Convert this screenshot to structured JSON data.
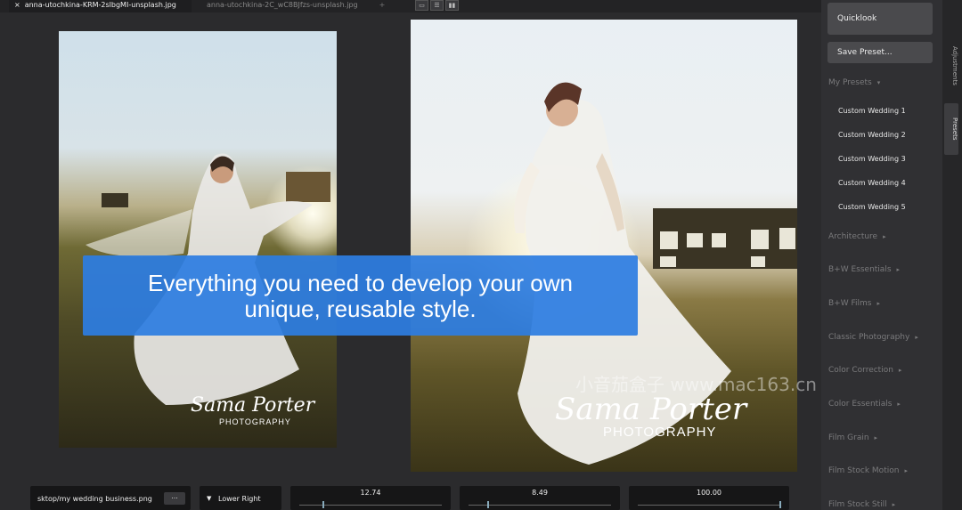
{
  "tabs": [
    {
      "label": "anna-utochkina-KRM-2slbgMI-unsplash.jpg",
      "active": true,
      "close_glyph": "×"
    },
    {
      "label": "anna-utochkina-2C_wC8BJfzs-unsplash.jpg",
      "active": false,
      "add_glyph": "+"
    }
  ],
  "view_buttons": [
    "single-view-icon",
    "split-horizontal-icon",
    "split-vertical-icon"
  ],
  "watermarks": {
    "left": {
      "script": "Sama Porter",
      "sub": "PHOTOGRAPHY"
    },
    "right": {
      "script": "Sama Porter",
      "sub": "PHOTOGRAPHY"
    }
  },
  "caption": {
    "line1": "Everything you need to develop your own",
    "line2": "unique, reusable style.",
    "color": "#2d7de1"
  },
  "site_watermark": "小音茄盒子 www.mac163.cn",
  "controls": {
    "path_value": "sktop/my wedding business.png",
    "browse_label": "...",
    "position_value": "Lower Right",
    "sliders": [
      {
        "value": "12.74",
        "fraction": 0.17
      },
      {
        "value": "8.49",
        "fraction": 0.14
      },
      {
        "value": "100.00",
        "fraction": 1.0
      }
    ]
  },
  "panel": {
    "quicklook_label": "Quicklook",
    "save_preset_label": "Save Preset...",
    "my_presets_label": "My Presets",
    "my_presets": [
      "Custom Wedding 1",
      "Custom Wedding 2",
      "Custom Wedding 3",
      "Custom Wedding 4",
      "Custom Wedding 5"
    ],
    "categories": [
      "Architecture",
      "B+W Essentials",
      "B+W Films",
      "Classic Photography",
      "Color Correction",
      "Color Essentials",
      "Film Grain",
      "Film Stock Motion",
      "Film Stock Still"
    ]
  },
  "side_tabs": {
    "adjustments": "Adjustments",
    "presets": "Presets"
  }
}
